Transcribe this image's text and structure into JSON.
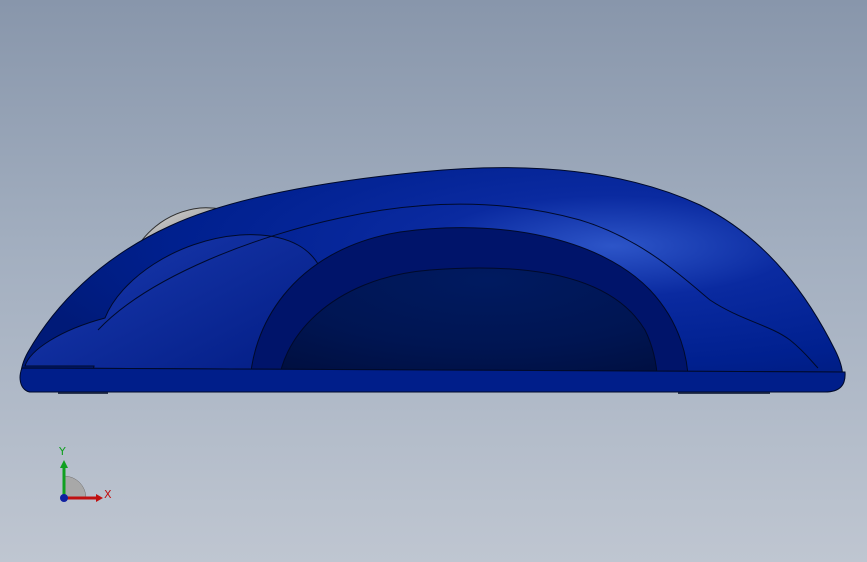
{
  "viewport": {
    "colors": {
      "background_top": "#8896ab",
      "background_bottom": "#bfc6d1",
      "body_main": "#001c8c",
      "body_light": "#2a4fc6",
      "body_dark": "#001040",
      "scroll_wheel": "#b8b8b8",
      "edge_line": "#000a2a"
    },
    "model": {
      "description_icon": "mouse-model"
    }
  },
  "triad": {
    "x_label": "X",
    "y_label": "Y",
    "x_color": "#c01010",
    "y_color": "#10a020",
    "z_color": "#1020a0"
  }
}
